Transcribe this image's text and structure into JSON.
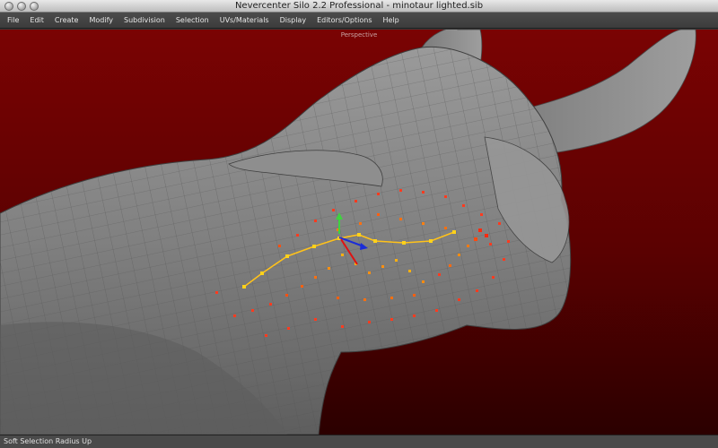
{
  "window": {
    "title": "Nevercenter Silo 2.2 Professional - minotaur lighted.sib"
  },
  "menubar": {
    "items": [
      "File",
      "Edit",
      "Create",
      "Modify",
      "Subdivision",
      "Selection",
      "UVs/Materials",
      "Display",
      "Editors/Options",
      "Help"
    ]
  },
  "viewport": {
    "label": "Perspective",
    "background_color": "#6b0202",
    "mesh_color": "#8a8a8a",
    "selection_color": "#ff3b1f",
    "edge_loop_color": "#ffc21a"
  },
  "statusbar": {
    "text": "Soft Selection Radius Up"
  }
}
